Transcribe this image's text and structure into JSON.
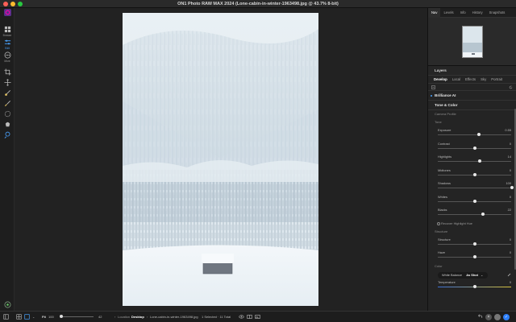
{
  "window": {
    "title": "ON1 Photo RAW MAX 2024 (Lone-cabin-in-winter-1963498.jpg @ 43.7% 8-bit)"
  },
  "left_toolbar": {
    "items": [
      {
        "label": "Browse",
        "icon": "grid-icon"
      },
      {
        "label": "Edit",
        "icon": "sliders-icon"
      },
      {
        "label": "More",
        "icon": "more-icon"
      }
    ],
    "tools": [
      "crop-icon",
      "move-icon",
      "brush-icon",
      "adjust-brush-icon",
      "masking-icon",
      "retouch-icon",
      "stamp-icon"
    ]
  },
  "right_panel": {
    "top_tabs": [
      "Nav",
      "Levels",
      "Info",
      "History",
      "Snapshots"
    ],
    "active_top_tab": "Nav",
    "layers_label": "Layers",
    "module_tabs": [
      "Develop",
      "Local",
      "Effects",
      "Sky",
      "Portrait"
    ],
    "active_module_tab": "Develop",
    "brilliance_label": "Brilliance AI",
    "tone_color_label": "Tone & Color",
    "camera_profile_label": "Camera Profile",
    "tone_group_label": "Tone",
    "tone_sliders": [
      {
        "name": "Exposure",
        "value": "0.55",
        "position": 0.55
      },
      {
        "name": "Contrast",
        "value": "0",
        "position": 0.5
      },
      {
        "name": "Highlights",
        "value": "14",
        "position": 0.57
      },
      {
        "name": "Midtones",
        "value": "0",
        "position": 0.5
      },
      {
        "name": "Shadows",
        "value": "100",
        "position": 1.0
      },
      {
        "name": "Whites",
        "value": "0",
        "position": 0.5
      },
      {
        "name": "Blacks",
        "value": "22",
        "position": 0.61
      }
    ],
    "recover_label": "Recover Highlight Hue",
    "structure_group_label": "Structure",
    "structure_sliders": [
      {
        "name": "Structure",
        "value": "0",
        "position": 0.5
      },
      {
        "name": "Haze",
        "value": "0",
        "position": 0.5
      }
    ],
    "color_group_label": "Color",
    "white_balance_label": "White Balance",
    "white_balance_value": "As Shot",
    "temperature_label": "Temperature",
    "temperature_value": "0",
    "temperature_position": 0.5
  },
  "bottom_bar": {
    "fit_label": "Fit",
    "zoom_value": "100",
    "slider_value": "42",
    "location_label": "Location",
    "location_value": "Desktop",
    "file_name": "Lone-cabin-in-winter-1963498.jpg",
    "selection_info": "1 Selected · 11 Total"
  }
}
